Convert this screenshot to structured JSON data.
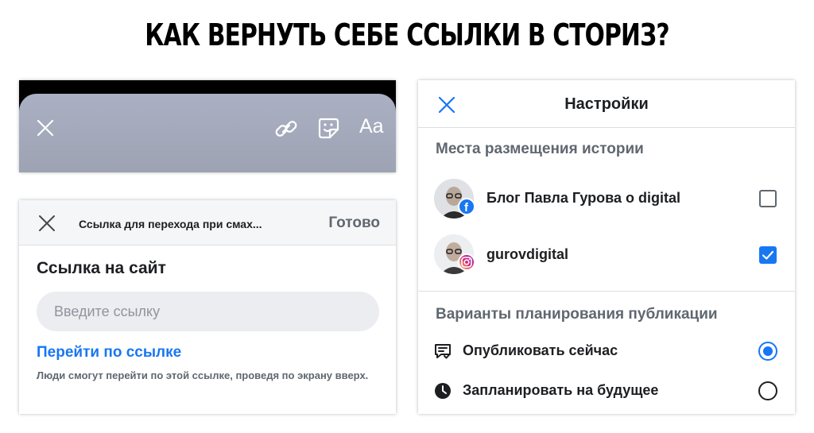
{
  "headline": "КАК ВЕРНУТЬ СЕБЕ ССЫЛКИ В СТОРИЗ?",
  "story_toolbar": {
    "close_icon": "close-icon",
    "link_icon": "link-icon",
    "sticker_icon": "sticker-icon",
    "text_tool": "Aa"
  },
  "link_dialog": {
    "title": "Ссылка для перехода при смах...",
    "done_label": "Готово",
    "field_label": "Ссылка на сайт",
    "input_value": "",
    "input_placeholder": "Введите ссылку",
    "preview_link": "Перейти по ссылке",
    "hint": "Люди смогут перейти по этой ссылке, проведя по экрану вверх."
  },
  "settings": {
    "title": "Настройки",
    "placement_heading": "Места размещения истории",
    "accounts": [
      {
        "name": "Блог Павла Гурова о digital",
        "platform": "facebook",
        "checked": false
      },
      {
        "name": "gurovdigital",
        "platform": "instagram",
        "checked": true
      }
    ],
    "schedule_heading": "Варианты планирования публикации",
    "options": [
      {
        "label": "Опубликовать сейчас",
        "icon": "publish-now-icon",
        "selected": true
      },
      {
        "label": "Запланировать на будущее",
        "icon": "clock-icon",
        "selected": false
      }
    ]
  },
  "colors": {
    "accent": "#1877f2",
    "story_sheet": "#a5abbd",
    "muted_text": "#606770",
    "facebook": "#1877f2",
    "instagram_gradient": [
      "#feda75",
      "#d62976",
      "#962fbf"
    ]
  }
}
